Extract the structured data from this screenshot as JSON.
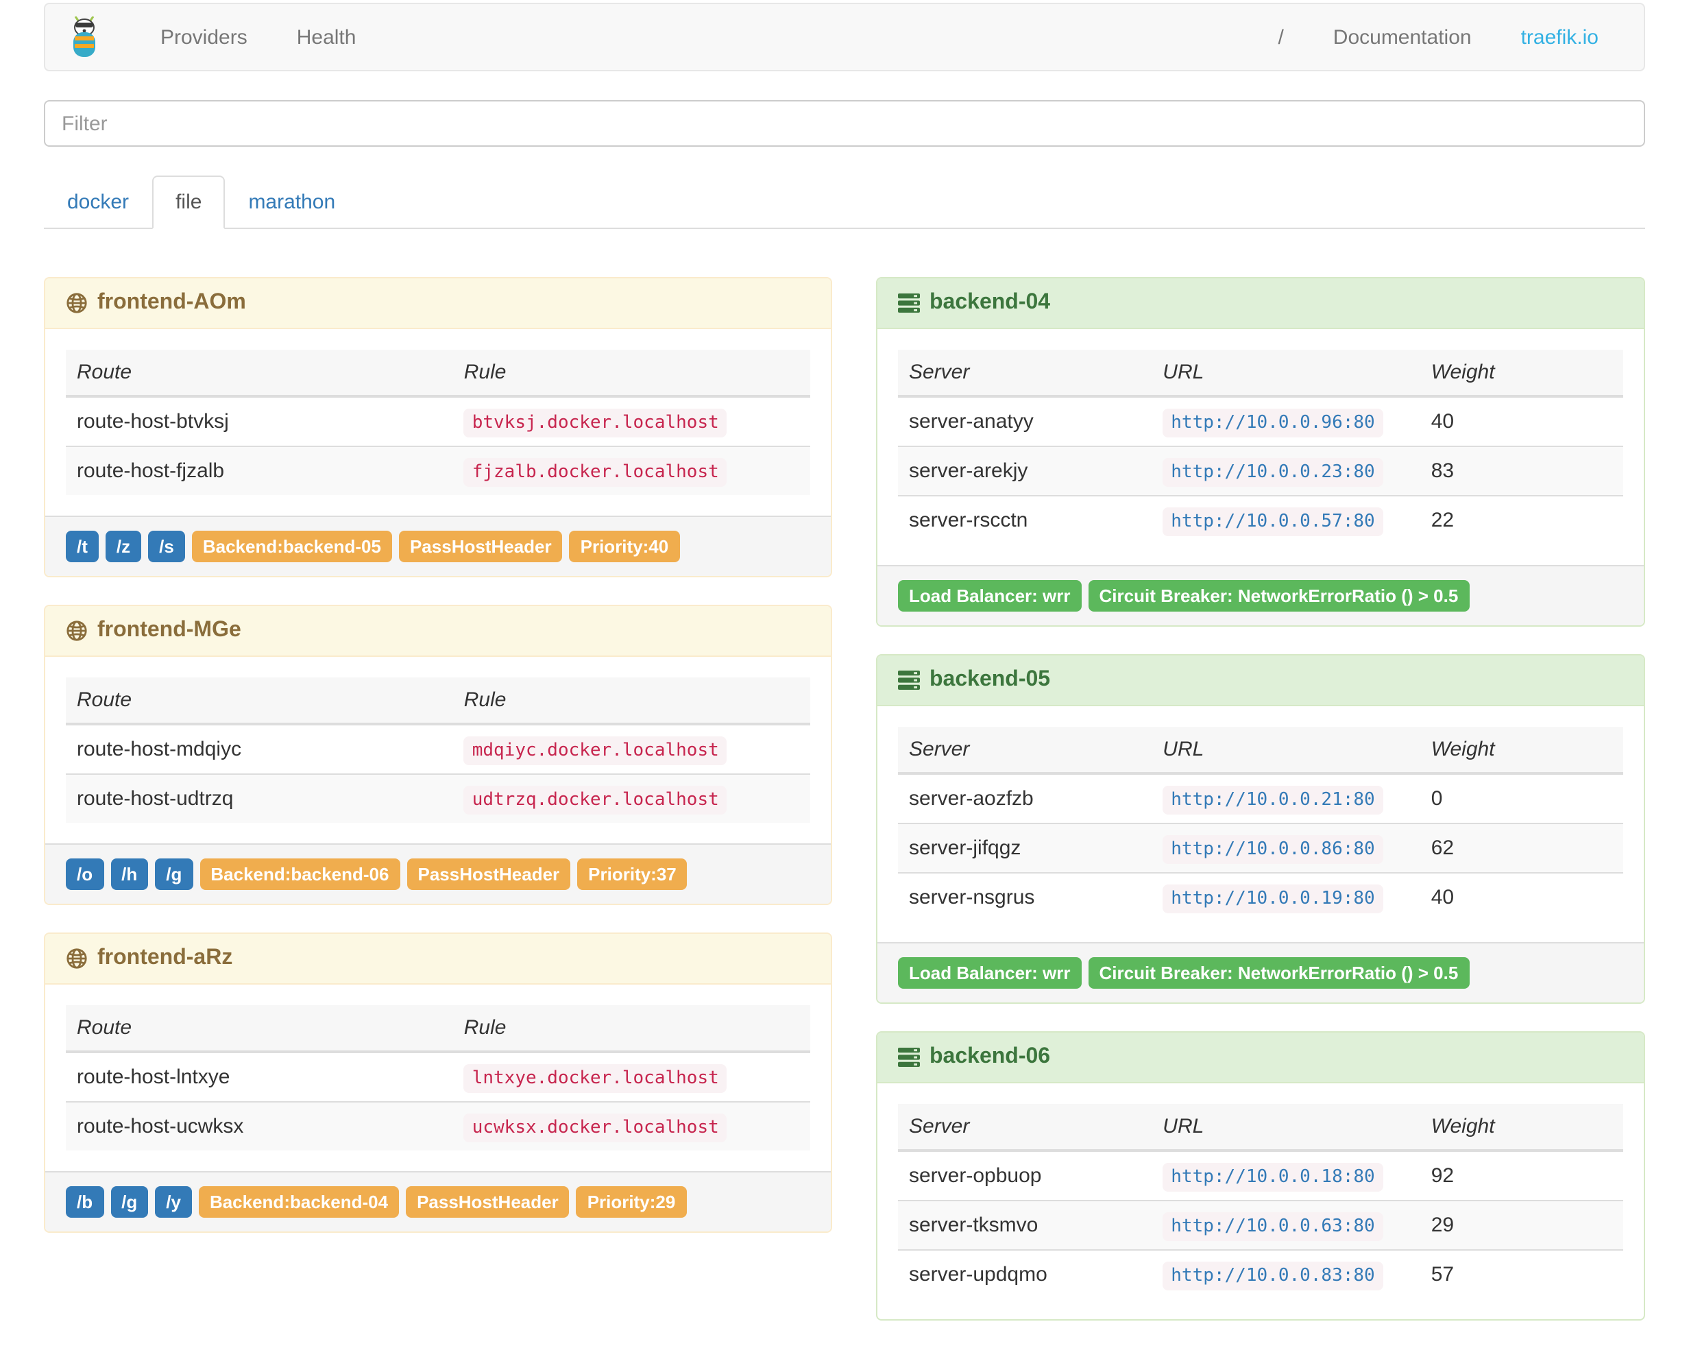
{
  "navbar": {
    "brand_icon": "traefik-logo",
    "providers_label": "Providers",
    "health_label": "Health",
    "separator": "/",
    "documentation_label": "Documentation",
    "site_link_label": "traefik.io"
  },
  "filter": {
    "placeholder": "Filter"
  },
  "tabs": [
    {
      "label": "docker",
      "active": false
    },
    {
      "label": "file",
      "active": true
    },
    {
      "label": "marathon",
      "active": false
    }
  ],
  "tables": {
    "frontend_columns": [
      "Route",
      "Rule"
    ],
    "backend_columns": [
      "Server",
      "URL",
      "Weight"
    ]
  },
  "frontends": [
    {
      "title": "frontend-AOm",
      "routes": [
        {
          "route": "route-host-btvksj",
          "rule": "btvksj.docker.localhost"
        },
        {
          "route": "route-host-fjzalb",
          "rule": "fjzalb.docker.localhost"
        }
      ],
      "entry_points": [
        "/t",
        "/z",
        "/s"
      ],
      "tags": [
        "Backend:backend-05",
        "PassHostHeader",
        "Priority:40"
      ]
    },
    {
      "title": "frontend-MGe",
      "routes": [
        {
          "route": "route-host-mdqiyc",
          "rule": "mdqiyc.docker.localhost"
        },
        {
          "route": "route-host-udtrzq",
          "rule": "udtrzq.docker.localhost"
        }
      ],
      "entry_points": [
        "/o",
        "/h",
        "/g"
      ],
      "tags": [
        "Backend:backend-06",
        "PassHostHeader",
        "Priority:37"
      ]
    },
    {
      "title": "frontend-aRz",
      "routes": [
        {
          "route": "route-host-lntxye",
          "rule": "lntxye.docker.localhost"
        },
        {
          "route": "route-host-ucwksx",
          "rule": "ucwksx.docker.localhost"
        }
      ],
      "entry_points": [
        "/b",
        "/g",
        "/y"
      ],
      "tags": [
        "Backend:backend-04",
        "PassHostHeader",
        "Priority:29"
      ]
    }
  ],
  "backends": [
    {
      "title": "backend-04",
      "servers": [
        {
          "name": "server-anatyy",
          "url": "http://10.0.0.96:80",
          "weight": "40"
        },
        {
          "name": "server-arekjy",
          "url": "http://10.0.0.23:80",
          "weight": "83"
        },
        {
          "name": "server-rscctn",
          "url": "http://10.0.0.57:80",
          "weight": "22"
        }
      ],
      "tags": [
        "Load Balancer: wrr",
        "Circuit Breaker: NetworkErrorRatio () > 0.5"
      ]
    },
    {
      "title": "backend-05",
      "servers": [
        {
          "name": "server-aozfzb",
          "url": "http://10.0.0.21:80",
          "weight": "0"
        },
        {
          "name": "server-jifqgz",
          "url": "http://10.0.0.86:80",
          "weight": "62"
        },
        {
          "name": "server-nsgrus",
          "url": "http://10.0.0.19:80",
          "weight": "40"
        }
      ],
      "tags": [
        "Load Balancer: wrr",
        "Circuit Breaker: NetworkErrorRatio () > 0.5"
      ]
    },
    {
      "title": "backend-06",
      "servers": [
        {
          "name": "server-opbuop",
          "url": "http://10.0.0.18:80",
          "weight": "92"
        },
        {
          "name": "server-tksmvo",
          "url": "http://10.0.0.63:80",
          "weight": "29"
        },
        {
          "name": "server-updqmo",
          "url": "http://10.0.0.83:80",
          "weight": "57"
        }
      ],
      "tags": []
    }
  ],
  "colors": {
    "frontend_heading_bg": "#fcf8e3",
    "frontend_heading_text": "#8a6d3b",
    "backend_heading_bg": "#dff0d8",
    "backend_heading_text": "#3c763d",
    "entrypoint_badge": "#337ab7",
    "setting_badge": "#f0ad4e",
    "balancer_badge": "#5cb85c",
    "rule_code_text": "#c7254e",
    "url_code_text": "#337ab7",
    "code_bg": "#f9f2f4",
    "site_link": "#33b1e3"
  }
}
